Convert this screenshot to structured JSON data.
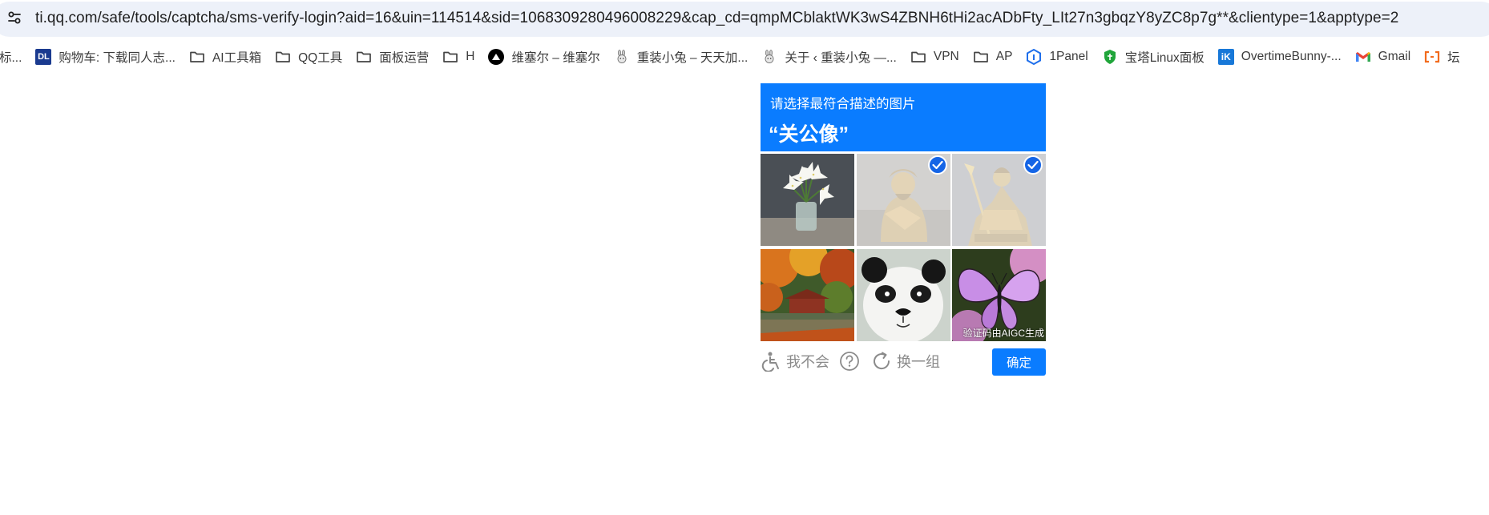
{
  "address_bar": {
    "url": "ti.qq.com/safe/tools/captcha/sms-verify-login?aid=16&uin=114514&sid=1068309280496008229&cap_cd=qmpMCblaktWK3wS4ZBNH6tHi2acADbFty_LIt27n3gbqzY8yZC8p7g**&clientype=1&apptype=2"
  },
  "bookmarks": [
    {
      "label": "标...",
      "icon": "none"
    },
    {
      "label": "购物车: 下载同人志...",
      "icon": "dl-logo-icon",
      "icon_text": "DL"
    },
    {
      "label": "AI工具箱",
      "icon": "folder-icon"
    },
    {
      "label": "QQ工具",
      "icon": "folder-icon"
    },
    {
      "label": "面板运营",
      "icon": "folder-icon"
    },
    {
      "label": "H",
      "icon": "folder-icon"
    },
    {
      "label": "维塞尔 – 维塞尔",
      "icon": "vercel-logo-icon"
    },
    {
      "label": "重装小兔 – 天天加...",
      "icon": "bunny-icon"
    },
    {
      "label": "关于 ‹ 重装小兔 —...",
      "icon": "bunny-icon"
    },
    {
      "label": "VPN",
      "icon": "folder-icon"
    },
    {
      "label": "AP",
      "icon": "folder-icon"
    },
    {
      "label": "1Panel",
      "icon": "1panel-logo-icon"
    },
    {
      "label": "宝塔Linux面板",
      "icon": "baota-logo-icon"
    },
    {
      "label": "OvertimeBunny-...",
      "icon": "ik-logo-icon",
      "icon_text": "iK"
    },
    {
      "label": "Gmail",
      "icon": "gmail-icon"
    },
    {
      "label": "坛",
      "icon": "bracket-logo-icon"
    }
  ],
  "captcha": {
    "prompt": "请选择最符合描述的图片",
    "keyword": "“关公像”",
    "tiles": [
      {
        "subject": "white-lilies-vase",
        "selected": false
      },
      {
        "subject": "golden-warrior-statue",
        "selected": true
      },
      {
        "subject": "guan-gong-statue",
        "selected": true
      },
      {
        "subject": "autumn-pavilion",
        "selected": false
      },
      {
        "subject": "panda-face",
        "selected": false
      },
      {
        "subject": "purple-butterfly",
        "selected": false
      }
    ],
    "watermark": "验证码由AIGC生成",
    "unable_label": "我不会",
    "refresh_label": "换一组",
    "confirm_label": "确定"
  },
  "colors": {
    "accent": "#0a7cff",
    "check": "#1565e6",
    "address_bg": "#edf1f9",
    "footer_text": "#8a8a8a"
  }
}
